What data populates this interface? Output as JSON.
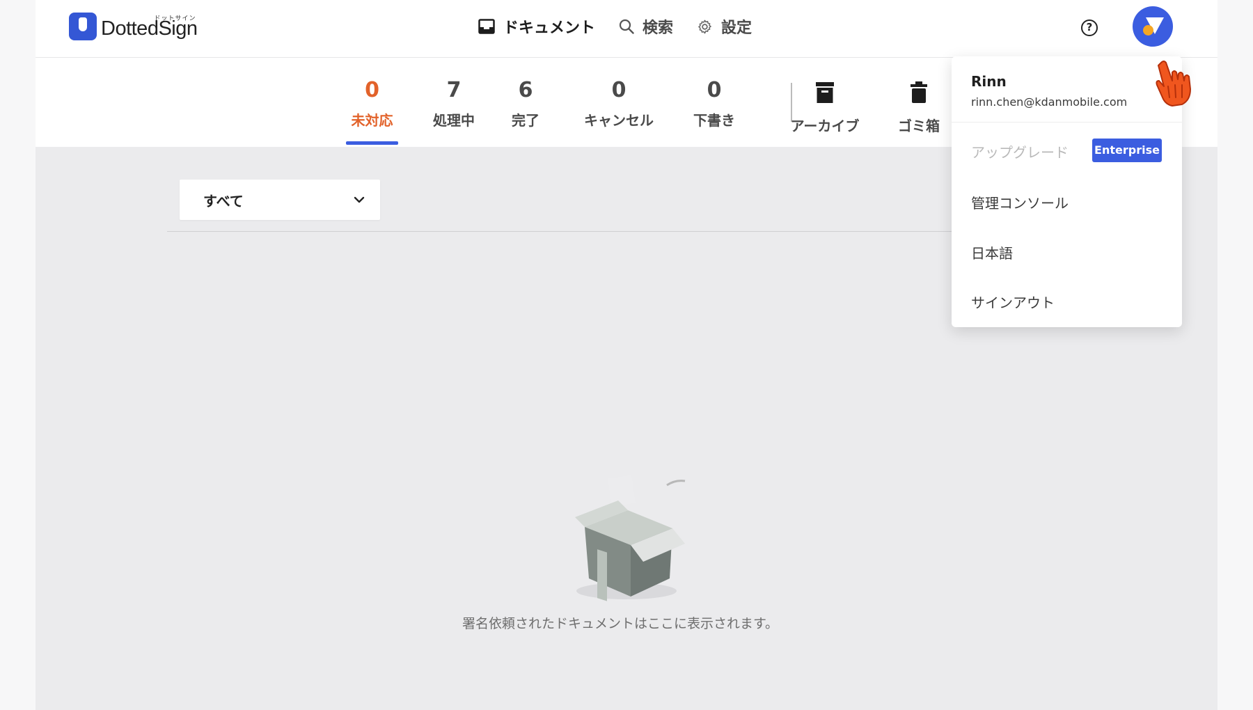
{
  "app": {
    "logo_text": "DottedSign",
    "logo_kana": "ドットサイン"
  },
  "nav": {
    "documents": "ドキュメント",
    "search": "検索",
    "settings": "設定"
  },
  "header": {
    "help_glyph": "?"
  },
  "tabs": [
    {
      "count": "0",
      "label": "未対応"
    },
    {
      "count": "7",
      "label": "処理中"
    },
    {
      "count": "6",
      "label": "完了"
    },
    {
      "count": "0",
      "label": "キャンセル"
    },
    {
      "count": "0",
      "label": "下書き"
    }
  ],
  "extra_tabs": {
    "archive": "アーカイブ",
    "trash": "ゴミ箱"
  },
  "filter": {
    "selected": "すべて"
  },
  "empty_state": {
    "message": "署名依頼されたドキュメントはここに表示されます。"
  },
  "user_menu": {
    "name": "Rinn",
    "email": "rinn.chen@kdanmobile.com",
    "upgrade": "アップグレード",
    "plan_badge": "Enterprise",
    "admin_console": "管理コンソール",
    "language": "日本語",
    "sign_out": "サインアウト"
  },
  "colors": {
    "accent": "#3b5de0",
    "active_tab": "#e2622a",
    "background": "#ebebed"
  }
}
